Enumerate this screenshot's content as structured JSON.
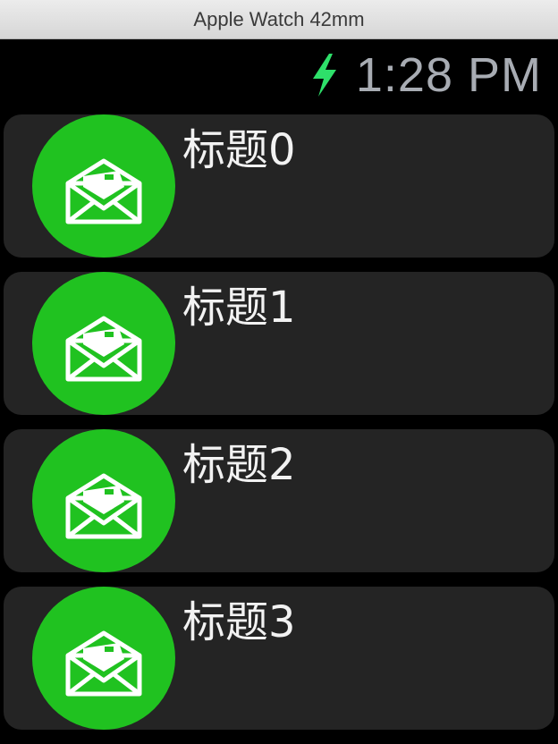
{
  "window": {
    "title": "Apple Watch 42mm"
  },
  "status": {
    "time": "1:28 PM",
    "charging_icon": "bolt-icon",
    "charging_color": "#2ee06a"
  },
  "list": {
    "accent_color": "#20c220",
    "items": [
      {
        "title": "标题0",
        "icon": "mail-open-icon"
      },
      {
        "title": "标题1",
        "icon": "mail-open-icon"
      },
      {
        "title": "标题2",
        "icon": "mail-open-icon"
      },
      {
        "title": "标题3",
        "icon": "mail-open-icon"
      }
    ]
  }
}
